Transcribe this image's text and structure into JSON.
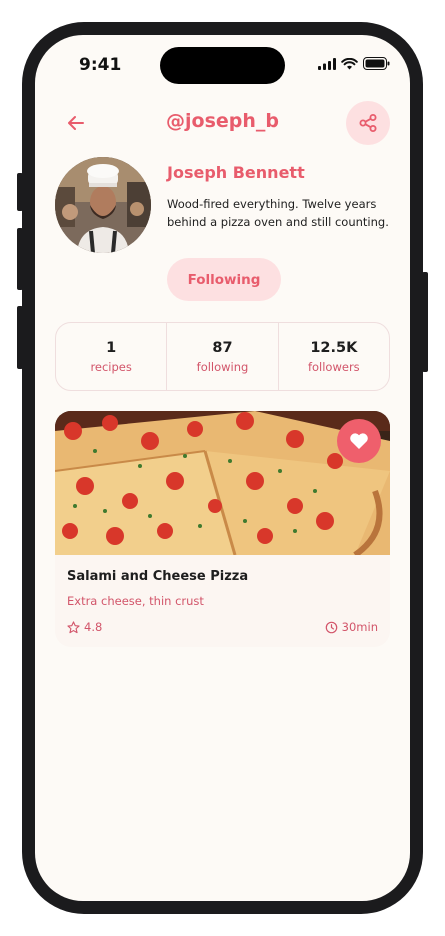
{
  "status_bar": {
    "time": "9:41"
  },
  "header": {
    "handle": "@joseph_b"
  },
  "profile": {
    "name": "Joseph Bennett",
    "bio": "Wood-fired everything. Twelve years behind a pizza oven and still counting.",
    "follow_label": "Following"
  },
  "stats": [
    {
      "value": "1",
      "label": "recipes"
    },
    {
      "value": "87",
      "label": "following"
    },
    {
      "value": "12.5K",
      "label": "followers"
    }
  ],
  "recipe": {
    "title": "Salami and Cheese Pizza",
    "subtitle": "Extra cheese, thin crust",
    "rating": "4.8",
    "duration": "30min"
  },
  "colors": {
    "accent": "#e85c6c",
    "accent_soft": "#fde0e1",
    "background": "#fdfaf6"
  },
  "icons": [
    "back-arrow-icon",
    "share-icon",
    "heart-icon",
    "star-icon",
    "clock-icon",
    "signal-icon",
    "wifi-icon",
    "battery-icon"
  ]
}
